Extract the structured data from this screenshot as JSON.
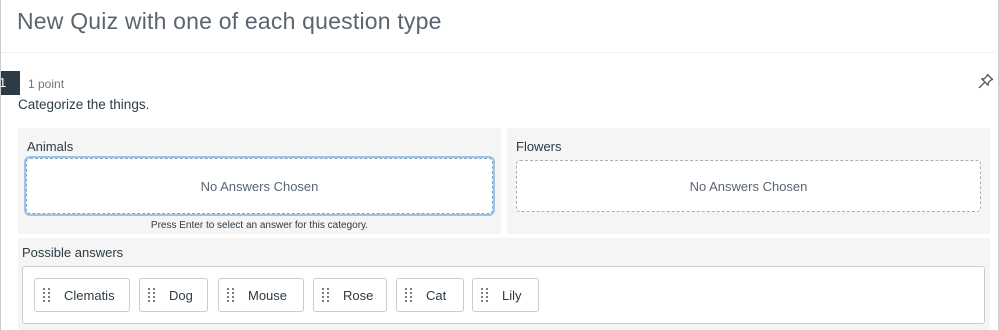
{
  "quiz": {
    "title": "New Quiz with one of each question type"
  },
  "question": {
    "number": "1",
    "points": "1 point",
    "prompt": "Categorize the things.",
    "pin_icon": "pin-icon"
  },
  "categories": [
    {
      "label": "Animals",
      "placeholder": "No Answers Chosen",
      "hint": "Press Enter to select an answer for this category."
    },
    {
      "label": "Flowers",
      "placeholder": "No Answers Chosen"
    }
  ],
  "possible_answers": {
    "label": "Possible answers",
    "grip_icon": "drag-handle-icon",
    "items": [
      "Clematis",
      "Dog",
      "Mouse",
      "Rose",
      "Cat",
      "Lily"
    ]
  },
  "colors": {
    "question_number_bg": "#2d3b45",
    "focus_ring": "#9fc3e3",
    "panel_bg": "#f5f5f5"
  }
}
